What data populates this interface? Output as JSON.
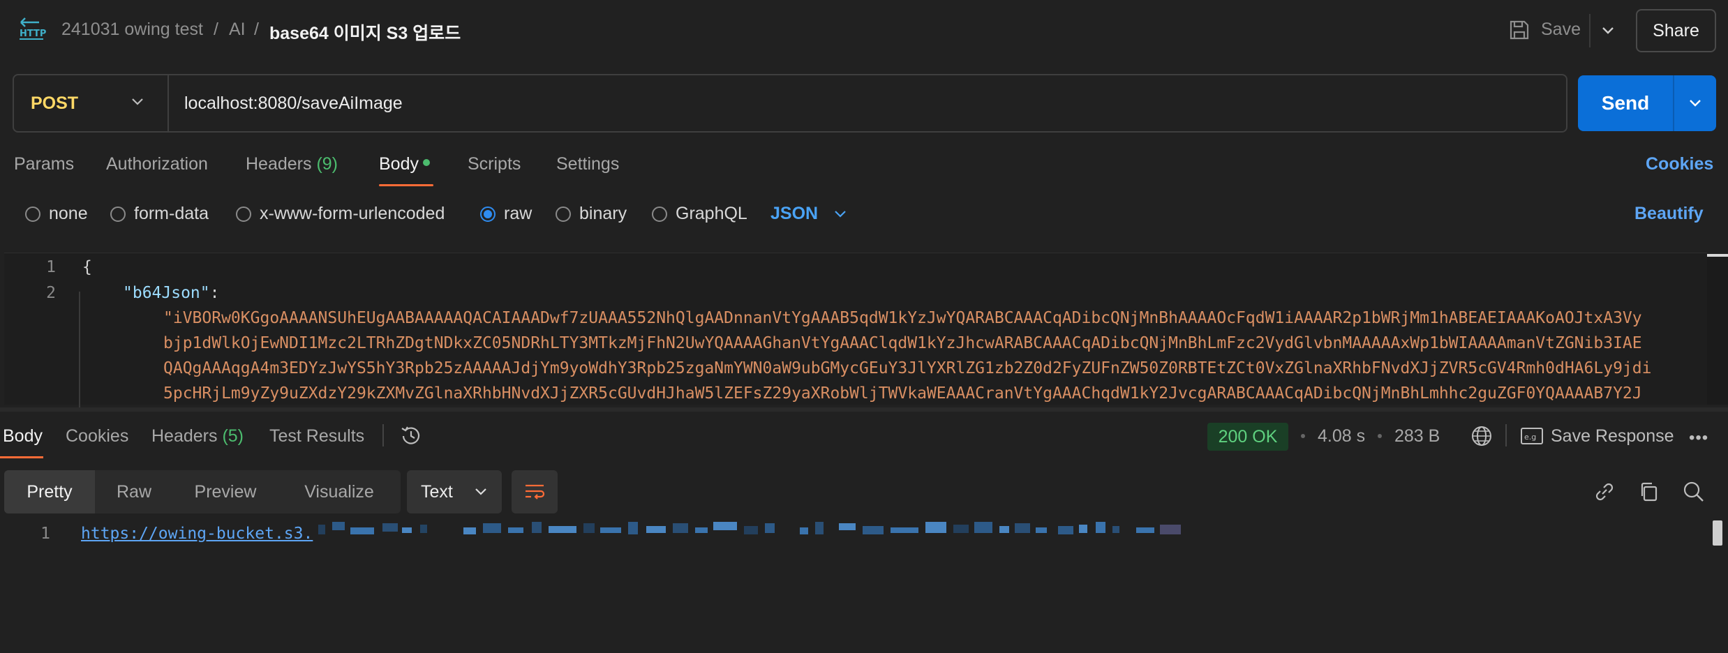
{
  "header": {
    "breadcrumb": {
      "collection": "241031 owing test",
      "sep1": "/",
      "folder": "AI",
      "sep2": "/",
      "request": "base64 이미지 S3 업로드"
    },
    "save_label": "Save",
    "share_label": "Share"
  },
  "request": {
    "method": "POST",
    "url": "localhost:8080/saveAiImage",
    "send_label": "Send"
  },
  "request_tabs": {
    "params": "Params",
    "authorization": "Authorization",
    "headers": "Headers",
    "headers_count": "(9)",
    "body": "Body",
    "scripts": "Scripts",
    "settings": "Settings",
    "cookies": "Cookies"
  },
  "body_types": {
    "none": "none",
    "form_data": "form-data",
    "urlencoded": "x-www-form-urlencoded",
    "raw": "raw",
    "binary": "binary",
    "graphql": "GraphQL",
    "selected": "raw",
    "format": "JSON",
    "beautify": "Beautify"
  },
  "editor": {
    "line1_num": "1",
    "line1": "{",
    "line2_num": "2",
    "key": "\"b64Json\"",
    "colon": ":",
    "value_lines": [
      "\"iVBORw0KGgoAAAANSUhEUgAABAAAAAQACAIAAADwf7zUAAA552NhQlgAADnnanVtYgAAAB5qdW1kYzJwYQARABCAAACqADibcQNjMnBhAAAAOcFqdW1iAAAAR2p1bWRjMm1hABEAEIAAAKoAOJtxA3Vy",
      "bjp1dWlkOjEwNDI1Mzc2LTRhZDgtNDkxZC05NDRhLTY3MTkzMjFhN2UwYQAAAAGhanVtYgAAAClqdW1kYzJhcwARABCAAACqADibcQNjMnBhLmFzc2VydGlvbnMAAAAAxWp1bWIAAAAmanVtZGNib3IAE",
      "QAQgAAAqgA4m3EDYzJwYS5hY3Rpb25zAAAAAJdjYm9yoWdhY3Rpb25zgaNmYWN0aW9ubGMycGEuY3JlYXRlZG1zb2Z0d2FyZUFnZW50Z0RBTEtZCt0VxZGlnaXRhbFNvdXJjZVR5cGV4Rmh0dHA6Ly9jdi",
      "5pcHRjLm9yZy9uZXdzY29kZXMvZGlnaXRhbHNvdXJjZXR5cGUvdHJhaW5lZEFsZ29yaXRobWljTWVkaWEAAACranVtYgAAAChqdW1kY2JvcgARABCAAACqADibcQNjMnBhLmhhc2guZGF0YQAAAAB7Y2J"
    ]
  },
  "response_tabs": {
    "body": "Body",
    "cookies": "Cookies",
    "headers": "Headers",
    "headers_count": "(5)",
    "test_results": "Test Results"
  },
  "response_meta": {
    "status": "200 OK",
    "time": "4.08 s",
    "size": "283 B",
    "save_response": "Save Response"
  },
  "response_view": {
    "pretty": "Pretty",
    "raw": "Raw",
    "preview": "Preview",
    "visualize": "Visualize",
    "language": "Text"
  },
  "response_body": {
    "line_num": "1",
    "url_visible": "https://owing-bucket.s3."
  },
  "colors": {
    "accent": "#ff6c37",
    "send": "#0b6fd8",
    "method": "#ffd866",
    "link": "#5ea6f5",
    "status_ok": "#5fd17f"
  },
  "icons": [
    "http-icon",
    "save-icon",
    "chevron-down-icon",
    "history-icon",
    "globe-icon",
    "save-response-icon",
    "more-icon",
    "link-icon",
    "copy-icon",
    "search-icon",
    "wrap-lines-icon"
  ]
}
